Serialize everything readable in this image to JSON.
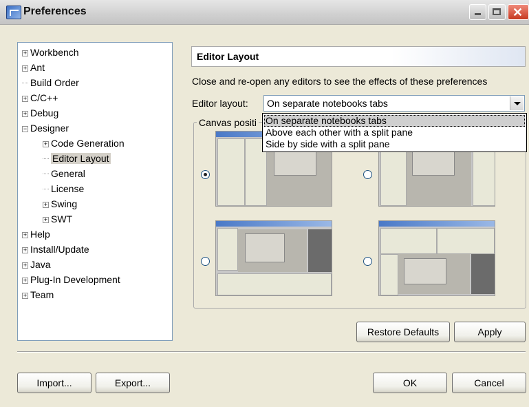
{
  "window": {
    "title": "Preferences"
  },
  "tree": {
    "items": [
      {
        "label": "Workbench",
        "expander": "+"
      },
      {
        "label": "Ant",
        "expander": "+"
      },
      {
        "label": "Build Order",
        "expander": ""
      },
      {
        "label": "C/C++",
        "expander": "+"
      },
      {
        "label": "Debug",
        "expander": "+"
      },
      {
        "label": "Designer",
        "expander": "−"
      },
      {
        "label": "Code Generation",
        "expander": "+"
      },
      {
        "label": "Editor Layout",
        "expander": ""
      },
      {
        "label": "General",
        "expander": ""
      },
      {
        "label": "License",
        "expander": ""
      },
      {
        "label": "Swing",
        "expander": "+"
      },
      {
        "label": "SWT",
        "expander": "+"
      },
      {
        "label": "Help",
        "expander": "+"
      },
      {
        "label": "Install/Update",
        "expander": "+"
      },
      {
        "label": "Java",
        "expander": "+"
      },
      {
        "label": "Plug-In Development",
        "expander": "+"
      },
      {
        "label": "Team",
        "expander": "+"
      }
    ],
    "selected": "Editor Layout"
  },
  "page": {
    "title": "Editor Layout",
    "description": "Close and re-open any editors to see the effects of these preferences",
    "layout_label": "Editor layout:",
    "layout_value": "On separate notebooks tabs",
    "layout_options": [
      "On separate notebooks tabs",
      "Above each other with a split pane",
      "Side by side with a split pane"
    ],
    "group_label": "Canvas positi"
  },
  "buttons": {
    "restore_defaults": "Restore Defaults",
    "apply": "Apply",
    "import": "Import...",
    "export": "Export...",
    "ok": "OK",
    "cancel": "Cancel"
  }
}
